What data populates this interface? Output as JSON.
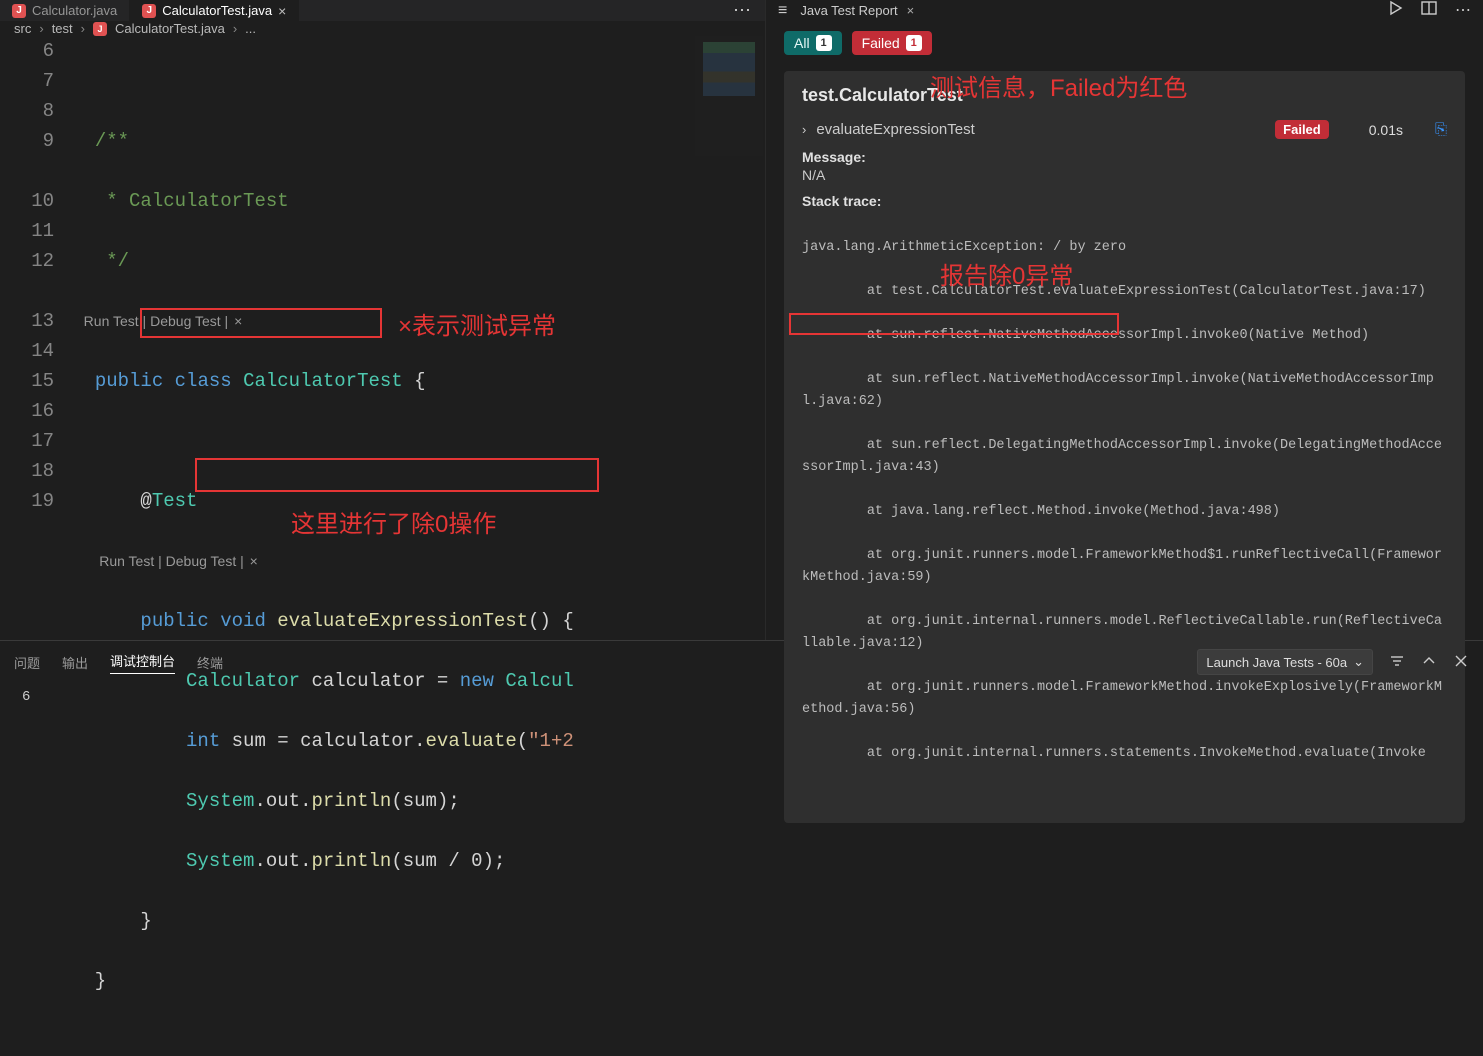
{
  "tabs": {
    "file1": "Calculator.java",
    "file2": "CalculatorTest.java"
  },
  "crumbs": {
    "a": "src",
    "b": "test",
    "c": "CalculatorTest.java",
    "d": "..."
  },
  "codelens": {
    "run": "Run Test",
    "debug": "Debug Test"
  },
  "code": {
    "ln6": "6",
    "ln7": "7",
    "ln8": "8",
    "ln9": "9",
    "ln10": "10",
    "ln11": "11",
    "ln12": "12",
    "ln13": "13",
    "ln14": "14",
    "ln15": "15",
    "ln16": "16",
    "ln17": "17",
    "ln18": "18",
    "ln19": "19",
    "cm1": "/**",
    "cm2": " * CalculatorTest",
    "cm3": " */",
    "public": "public",
    "class": "class",
    "void": "void",
    "new": "new",
    "int": "int",
    "CalculatorTest": "CalculatorTest",
    "Calculator": "Calculator",
    "Calcul": "Calcul",
    "Test": "Test",
    "at": "@",
    "eval": "evaluateExpressionTest",
    "calculator": "calculator",
    "System": "System",
    "out": "out",
    "println": "println",
    "sum": "sum",
    "evaluate": "evaluate",
    "lit": "\"1+2",
    "zero": "0"
  },
  "annot": {
    "a1": "×表示测试异常",
    "a2": "这里进行了除0操作",
    "a3": "测试信息，Failed为红色",
    "a4": "报告除0异常"
  },
  "report": {
    "tab": "Java Test Report",
    "all": "All",
    "allCount": "1",
    "failed": "Failed",
    "failedCount": "1",
    "suite": "test.CalculatorTest",
    "method": "evaluateExpressionTest",
    "failedBadge": "Failed",
    "duration": "0.01s",
    "msgLabel": "Message:",
    "msgVal": "N/A",
    "traceLabel": "Stack trace:",
    "trace0": "java.lang.ArithmeticException: / by zero",
    "trace1": "        at test.CalculatorTest.evaluateExpressionTest(CalculatorTest.java:17)",
    "trace2": "        at sun.reflect.NativeMethodAccessorImpl.invoke0(Native Method)",
    "trace3": "        at sun.reflect.NativeMethodAccessorImpl.invoke(NativeMethodAccessorImpl.java:62)",
    "trace4": "        at sun.reflect.DelegatingMethodAccessorImpl.invoke(DelegatingMethodAccessorImpl.java:43)",
    "trace5": "        at java.lang.reflect.Method.invoke(Method.java:498)",
    "trace6": "        at org.junit.runners.model.FrameworkMethod$1.runReflectiveCall(FrameworkMethod.java:59)",
    "trace7": "        at org.junit.internal.runners.model.ReflectiveCallable.run(ReflectiveCallable.java:12)",
    "trace8": "        at org.junit.runners.model.FrameworkMethod.invokeExplosively(FrameworkMethod.java:56)",
    "trace9": "        at org.junit.internal.runners.statements.InvokeMethod.evaluate(Invoke"
  },
  "bottom": {
    "t1": "问题",
    "t2": "输出",
    "t3": "调试控制台",
    "t4": "终端",
    "launch": "Launch Java Tests - 60a",
    "out": "6"
  }
}
